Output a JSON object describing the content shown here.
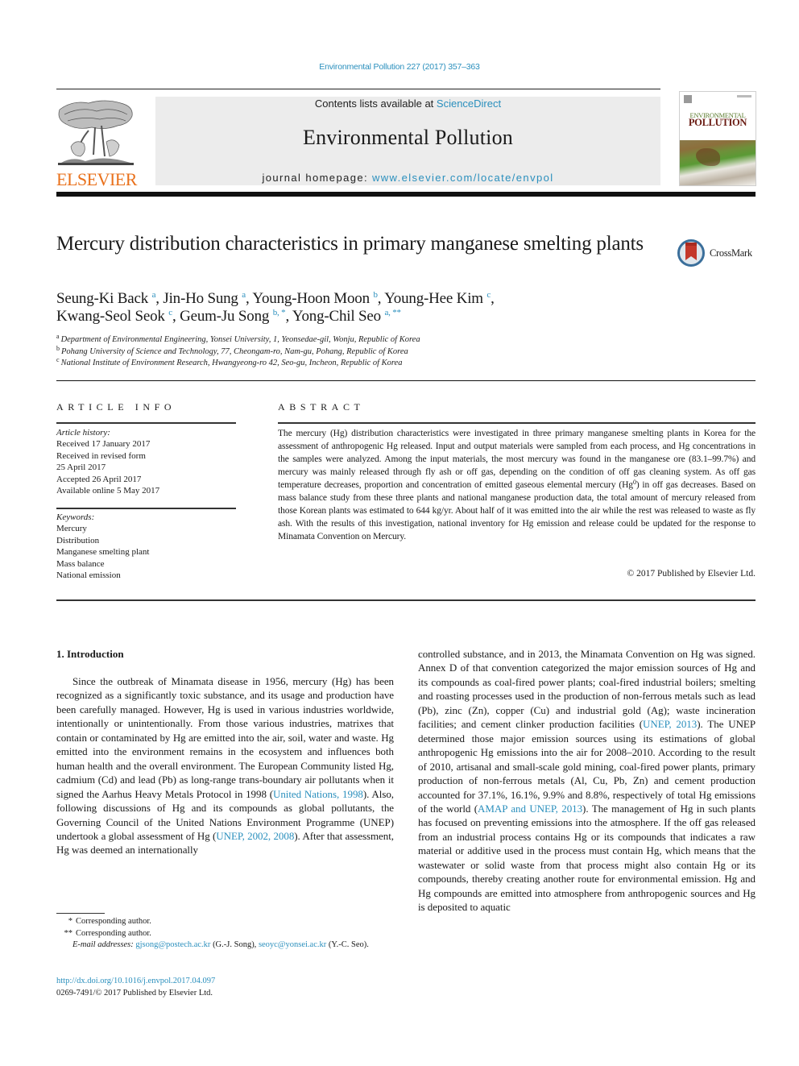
{
  "header": {
    "citation": "Environmental Pollution 227 (2017) 357–363",
    "contents_prefix": "Contents lists available at ",
    "contents_link": "ScienceDirect",
    "journal_name": "Environmental Pollution",
    "homepage_prefix": "journal homepage: ",
    "homepage_link": "www.elsevier.com/locate/envpol",
    "publisher_logo_text": "ELSEVIER",
    "cover": {
      "title_line1": "ENVIRONMENTAL",
      "title_line2": "POLLUTION"
    },
    "colors": {
      "link": "#2a8fbd",
      "elsevier_orange": "#e9711c",
      "band_gray": "#ececec"
    }
  },
  "article": {
    "title": "Mercury distribution characteristics in primary manganese smelting plants",
    "crossmark_label": "CrossMark",
    "authors": [
      {
        "name": "Seung-Ki Back",
        "sup": "a",
        "sep": ", "
      },
      {
        "name": "Jin-Ho Sung",
        "sup": "a",
        "sep": ", "
      },
      {
        "name": "Young-Hoon Moon",
        "sup": "b",
        "sep": ", "
      },
      {
        "name": "Young-Hee Kim",
        "sup": "c",
        "sep": ","
      },
      {
        "name": "Kwang-Seol Seok",
        "sup": "c",
        "sep": ", "
      },
      {
        "name": "Geum-Ju Song",
        "sup": "b, *",
        "sep": ", "
      },
      {
        "name": "Yong-Chil Seo",
        "sup": "a, **",
        "sep": ""
      }
    ],
    "affiliations": [
      {
        "key": "a",
        "text": "Department of Environmental Engineering, Yonsei University, 1, Yeonsedae-gil, Wonju, Republic of Korea"
      },
      {
        "key": "b",
        "text": "Pohang University of Science and Technology, 77, Cheongam-ro, Nam-gu, Pohang, Republic of Korea"
      },
      {
        "key": "c",
        "text": "National Institute of Environment Research, Hwangyeong-ro 42, Seo-gu, Incheon, Republic of Korea"
      }
    ]
  },
  "article_info": {
    "heading": "ARTICLE INFO",
    "history_label": "Article history:",
    "history": [
      "Received 17 January 2017",
      "Received in revised form",
      "25 April 2017",
      "Accepted 26 April 2017",
      "Available online 5 May 2017"
    ],
    "keywords_label": "Keywords:",
    "keywords": [
      "Mercury",
      "Distribution",
      "Manganese smelting plant",
      "Mass balance",
      "National emission"
    ]
  },
  "abstract": {
    "heading": "ABSTRACT",
    "text_part1": "The mercury (Hg) distribution characteristics were investigated in three primary manganese smelting plants in Korea for the assessment of anthropogenic Hg released. Input and output materials were sampled from each process, and Hg concentrations in the samples were analyzed. Among the input materials, the most mercury was found in the manganese ore (83.1–99.7%) and mercury was mainly released through fly ash or off gas, depending on the condition of off gas cleaning system. As off gas temperature decreases, proportion and concentration of emitted gaseous elemental mercury (Hg",
    "text_sup": "0",
    "text_part2": ") in off gas decreases. Based on mass balance study from these three plants and national manganese production data, the total amount of mercury released from those Korean plants was estimated to 644 kg/yr. About half of it was emitted into the air while the rest was released to waste as fly ash. With the results of this investigation, national inventory for Hg emission and release could be updated for the response to Minamata Convention on Mercury.",
    "copyright": "© 2017 Published by Elsevier Ltd."
  },
  "body": {
    "intro_heading": "1.  Introduction",
    "left": {
      "t1": "Since the outbreak of Minamata disease in 1956, mercury (Hg) has been recognized as a significantly toxic substance, and its usage and production have been carefully managed. However, Hg is used in various industries worldwide, intentionally or unintentionally. From those various industries, matrixes that contain or contaminated by Hg are emitted into the air, soil, water and waste. Hg emitted into the environment remains in the ecosystem and influences both human health and the overall environment. The European Community listed Hg, cadmium (Cd) and lead (Pb) as long-range trans-boundary air pollutants when it signed the Aarhus Heavy Metals Protocol in 1998 (",
      "ref1": "United Nations, 1998",
      "t2": "). Also, following discussions of Hg and its compounds as global pollutants, the Governing Council of the United Nations Environment Programme (UNEP) undertook a global assessment of Hg (",
      "ref2": "UNEP, 2002, 2008",
      "t3": "). After that assessment, Hg was deemed an internationally"
    },
    "right": {
      "t1": "controlled substance, and in 2013, the Minamata Convention on Hg was signed. Annex D of that convention categorized the major emission sources of Hg and its compounds as coal-fired power plants; coal-fired industrial boilers; smelting and roasting processes used in the production of non-ferrous metals such as lead (Pb), zinc (Zn), copper (Cu) and industrial gold (Ag); waste incineration facilities; and cement clinker production facilities (",
      "ref1": "UNEP, 2013",
      "t2": "). The UNEP determined those major emission sources using its estimations of global anthropogenic Hg emissions into the air for 2008–2010. According to the result of 2010, artisanal and small-scale gold mining, coal-fired power plants, primary production of non-ferrous metals (Al, Cu, Pb, Zn) and cement production accounted for 37.1%, 16.1%, 9.9% and 8.8%, respectively of total Hg emissions of the world (",
      "ref2": "AMAP and UNEP, 2013",
      "t3": "). The management of Hg in such plants has focused on preventing emissions into the atmosphere. If the off gas released from an industrial process contains Hg or its compounds that indicates a raw material or additive used in the process must contain Hg, which means that the wastewater or solid waste from that process might also contain Hg or its compounds, thereby creating another route for environmental emission. Hg and Hg compounds are emitted into atmosphere from anthropogenic sources and Hg is deposited to aquatic"
    }
  },
  "footnotes": {
    "corr1_mark": "*",
    "corr1_text": "Corresponding author.",
    "corr2_mark": "**",
    "corr2_text": "Corresponding author.",
    "email_label": "E-mail addresses:",
    "email1": "gjsong@postech.ac.kr",
    "email1_who": " (G.-J. Song), ",
    "email2": "seoyc@yonsei.ac.kr",
    "email2_who": " (Y.-C. Seo).",
    "doi": "http://dx.doi.org/10.1016/j.envpol.2017.04.097",
    "issn_copyright": "0269-7491/© 2017 Published by Elsevier Ltd."
  }
}
